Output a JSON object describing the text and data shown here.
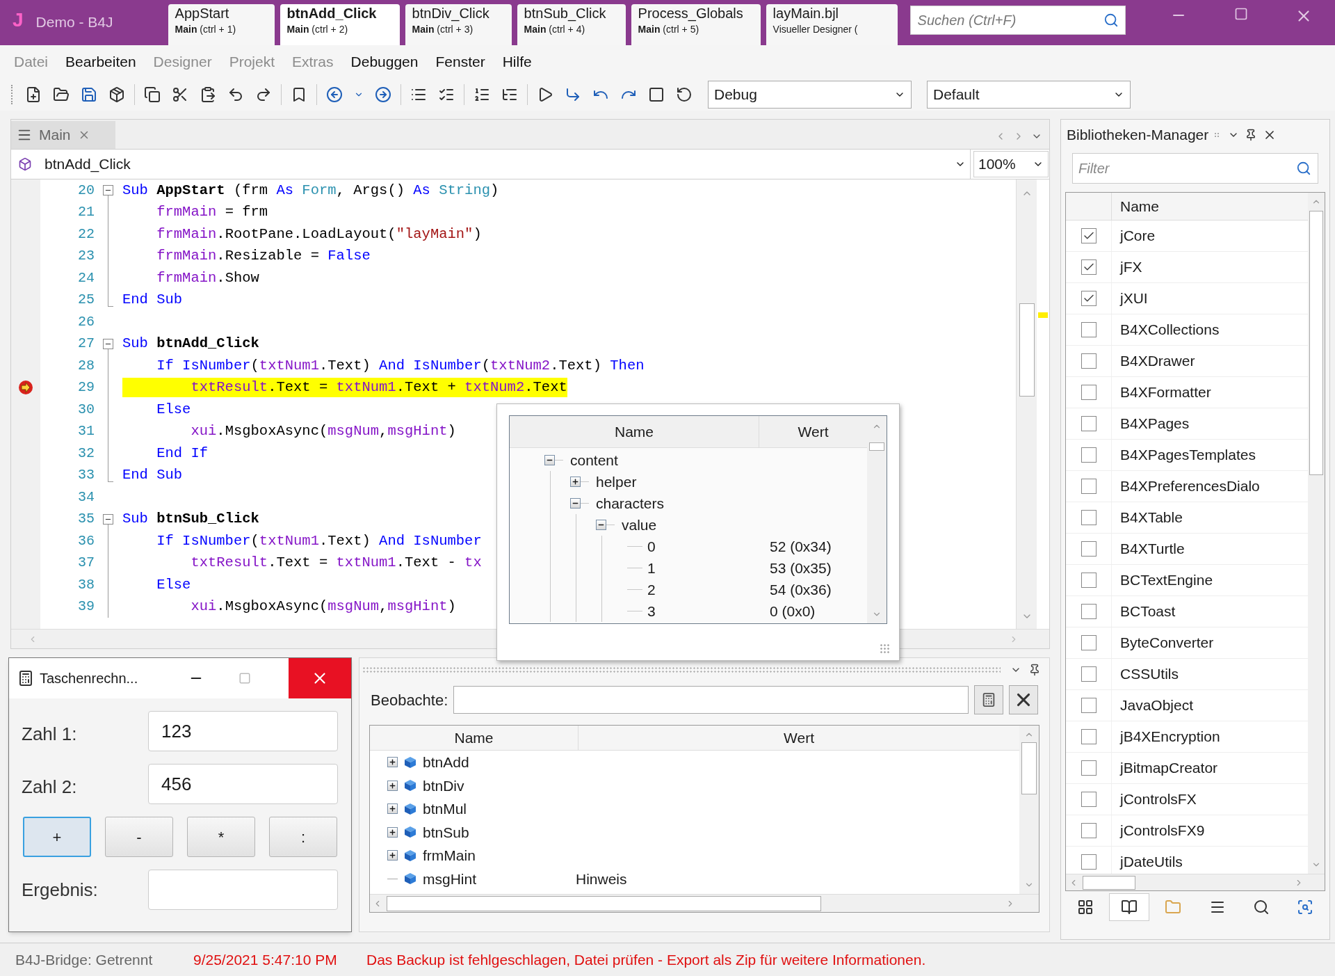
{
  "title_bar": {
    "logo": "J",
    "title": "Demo - B4J",
    "tabs": [
      {
        "title": "AppStart",
        "subtitle": "**Main** (ctrl + 1)",
        "selected": false
      },
      {
        "title": "btnAdd_Click",
        "subtitle": "**Main** (ctrl + 2)",
        "selected": true
      },
      {
        "title": "btnDiv_Click",
        "subtitle": "**Main** (ctrl + 3)",
        "selected": false
      },
      {
        "title": "btnSub_Click",
        "subtitle": "**Main** (ctrl + 4)",
        "selected": false
      },
      {
        "title": "Process_Globals",
        "subtitle": "**Main** (ctrl + 5)",
        "selected": false
      },
      {
        "title": "layMain.bjl",
        "subtitle": "Visueller Designer (",
        "selected": false
      }
    ],
    "search": {
      "placeholder": "Suchen (Ctrl+F)"
    }
  },
  "menu": [
    {
      "label": "Datei",
      "disabled": true
    },
    {
      "label": "Bearbeiten",
      "disabled": false
    },
    {
      "label": "Designer",
      "disabled": true
    },
    {
      "label": "Projekt",
      "disabled": true
    },
    {
      "label": "Extras",
      "disabled": true
    },
    {
      "label": "Debuggen",
      "disabled": false
    },
    {
      "label": "Fenster",
      "disabled": false
    },
    {
      "label": "Hilfe",
      "disabled": false
    }
  ],
  "toolbar": {
    "build_config": "Debug",
    "theme": "Default"
  },
  "editor": {
    "tab": "Main",
    "sub": "btnAdd_Click",
    "zoom": "100%",
    "lines": [
      {
        "number": "20",
        "kind": "start",
        "tokens": [
          {
            "kind": "kw",
            "text": "Sub "
          },
          {
            "kind": "name",
            "text": "AppStart"
          },
          {
            "kind": "plain",
            "text": " (frm "
          },
          {
            "kind": "kw",
            "text": "As "
          },
          {
            "kind": "type",
            "text": "Form"
          },
          {
            "kind": "plain",
            "text": ", Args() "
          },
          {
            "kind": "kw",
            "text": "As "
          },
          {
            "kind": "type",
            "text": "String"
          },
          {
            "kind": "plain",
            "text": ")"
          }
        ]
      },
      {
        "number": "21",
        "kind": "inner",
        "tokens": [
          {
            "kind": "var",
            "text": "    frmMain"
          },
          {
            "kind": "plain",
            "text": " = frm"
          }
        ]
      },
      {
        "number": "22",
        "kind": "inner",
        "tokens": [
          {
            "kind": "var",
            "text": "    frmMain"
          },
          {
            "kind": "plain",
            "text": ".RootPane.LoadLayout("
          },
          {
            "kind": "str",
            "text": "\"layMain\""
          },
          {
            "kind": "plain",
            "text": ")"
          }
        ]
      },
      {
        "number": "23",
        "kind": "inner",
        "tokens": [
          {
            "kind": "var",
            "text": "    frmMain"
          },
          {
            "kind": "plain",
            "text": ".Resizable = "
          },
          {
            "kind": "kw",
            "text": "False"
          }
        ]
      },
      {
        "number": "24",
        "kind": "inner",
        "tokens": [
          {
            "kind": "var",
            "text": "    frmMain"
          },
          {
            "kind": "plain",
            "text": ".Show"
          }
        ]
      },
      {
        "number": "25",
        "kind": "end",
        "tokens": [
          {
            "kind": "kw",
            "text": "End Sub"
          }
        ]
      },
      {
        "number": "26",
        "kind": "blank"
      },
      {
        "number": "27",
        "kind": "start",
        "tokens": [
          {
            "kind": "kw",
            "text": "Sub "
          },
          {
            "kind": "name",
            "text": "btnAdd_Click"
          }
        ]
      },
      {
        "number": "28",
        "kind": "inner",
        "tokens": [
          {
            "kind": "kw",
            "text": "    If IsNumber"
          },
          {
            "kind": "plain",
            "text": "("
          },
          {
            "kind": "var",
            "text": "txtNum1"
          },
          {
            "kind": "plain",
            "text": ".Text) "
          },
          {
            "kind": "kw",
            "text": "And IsNumber"
          },
          {
            "kind": "plain",
            "text": "("
          },
          {
            "kind": "var",
            "text": "txtNum2"
          },
          {
            "kind": "plain",
            "text": ".Text) "
          },
          {
            "kind": "kw",
            "text": "Then"
          }
        ]
      },
      {
        "number": "29",
        "kind": "inner",
        "highlight": true,
        "breakpoint": true,
        "tokens": [
          {
            "kind": "var",
            "text": "        txtResult"
          },
          {
            "kind": "plain",
            "text": ".Text = "
          },
          {
            "kind": "var",
            "text": "txtNum1"
          },
          {
            "kind": "plain",
            "text": ".Text + "
          },
          {
            "kind": "var",
            "text": "txtNum2"
          },
          {
            "kind": "plain",
            "text": ".Text"
          }
        ]
      },
      {
        "number": "30",
        "kind": "inner",
        "tokens": [
          {
            "kind": "kw",
            "text": "    Else"
          }
        ]
      },
      {
        "number": "31",
        "kind": "inner",
        "tokens": [
          {
            "kind": "var",
            "text": "        xui"
          },
          {
            "kind": "plain",
            "text": ".MsgboxAsync("
          },
          {
            "kind": "var",
            "text": "msgNum"
          },
          {
            "kind": "plain",
            "text": ","
          },
          {
            "kind": "var",
            "text": "msgHint"
          },
          {
            "kind": "plain",
            "text": ")"
          }
        ]
      },
      {
        "number": "32",
        "kind": "inner",
        "tokens": [
          {
            "kind": "kw",
            "text": "    End If"
          }
        ]
      },
      {
        "number": "33",
        "kind": "end",
        "tokens": [
          {
            "kind": "kw",
            "text": "End Sub"
          }
        ]
      },
      {
        "number": "34",
        "kind": "blank"
      },
      {
        "number": "35",
        "kind": "start",
        "tokens": [
          {
            "kind": "kw",
            "text": "Sub "
          },
          {
            "kind": "name",
            "text": "btnSub_Click"
          }
        ]
      },
      {
        "number": "36",
        "kind": "inner",
        "tokens": [
          {
            "kind": "kw",
            "text": "    If IsNumber"
          },
          {
            "kind": "plain",
            "text": "("
          },
          {
            "kind": "var",
            "text": "txtNum1"
          },
          {
            "kind": "plain",
            "text": ".Text) "
          },
          {
            "kind": "kw",
            "text": "And IsNumber"
          }
        ]
      },
      {
        "number": "37",
        "kind": "inner",
        "tokens": [
          {
            "kind": "var",
            "text": "        txtResult"
          },
          {
            "kind": "plain",
            "text": ".Text = "
          },
          {
            "kind": "var",
            "text": "txtNum1"
          },
          {
            "kind": "plain",
            "text": ".Text - "
          },
          {
            "kind": "var",
            "text": "tx"
          }
        ]
      },
      {
        "number": "38",
        "kind": "inner",
        "tokens": [
          {
            "kind": "kw",
            "text": "    Else"
          }
        ]
      },
      {
        "number": "39",
        "kind": "inner",
        "tokens": [
          {
            "kind": "var",
            "text": "        xui"
          },
          {
            "kind": "plain",
            "text": ".MsgboxAsync("
          },
          {
            "kind": "var",
            "text": "msgNum"
          },
          {
            "kind": "plain",
            "text": ","
          },
          {
            "kind": "var",
            "text": "msgHint"
          },
          {
            "kind": "plain",
            "text": ")"
          }
        ]
      }
    ]
  },
  "popup": {
    "columns": [
      "Name",
      "Wert"
    ],
    "tree": [
      {
        "name": "content",
        "expanded": true,
        "children": [
          {
            "name": "helper",
            "expanded": false
          },
          {
            "name": "characters",
            "expanded": true,
            "children": [
              {
                "name": "value",
                "expanded": true,
                "children": [
                  {
                    "name": "0",
                    "value": "52 (0x34)"
                  },
                  {
                    "name": "1",
                    "value": "53 (0x35)"
                  },
                  {
                    "name": "2",
                    "value": "54 (0x36)"
                  },
                  {
                    "name": "3",
                    "value": "0 (0x0)"
                  }
                ]
              }
            ]
          }
        ]
      }
    ]
  },
  "calculator": {
    "title": "Taschenrechn...",
    "fields": [
      {
        "label": "Zahl 1:",
        "value": "123"
      },
      {
        "label": "Zahl 2:",
        "value": "456"
      }
    ],
    "buttons": [
      {
        "label": "+",
        "focused": true
      },
      {
        "label": "-",
        "focused": false
      },
      {
        "label": "*",
        "focused": false
      },
      {
        "label": ":",
        "focused": false
      }
    ],
    "result_label": "Ergebnis:"
  },
  "watch": {
    "label": "Beobachte:",
    "columns": [
      "Name",
      "Wert"
    ],
    "rows": [
      {
        "name": "btnAdd",
        "expanded": false
      },
      {
        "name": "btnDiv",
        "expanded": false
      },
      {
        "name": "btnMul",
        "expanded": false
      },
      {
        "name": "btnSub",
        "expanded": false
      },
      {
        "name": "frmMain",
        "expanded": false
      },
      {
        "name": "msgHint",
        "value": "Hinweis"
      }
    ]
  },
  "libraries": {
    "title": "Bibliotheken-Manager",
    "filter_placeholder": "Filter",
    "column": "Name",
    "items": [
      {
        "name": "jCore",
        "checked": true
      },
      {
        "name": "jFX",
        "checked": true
      },
      {
        "name": "jXUI",
        "checked": true
      },
      {
        "name": "B4XCollections",
        "checked": false
      },
      {
        "name": "B4XDrawer",
        "checked": false
      },
      {
        "name": "B4XFormatter",
        "checked": false
      },
      {
        "name": "B4XPages",
        "checked": false
      },
      {
        "name": "B4XPagesTemplates",
        "checked": false
      },
      {
        "name": "B4XPreferencesDialo",
        "checked": false
      },
      {
        "name": "B4XTable",
        "checked": false
      },
      {
        "name": "B4XTurtle",
        "checked": false
      },
      {
        "name": "BCTextEngine",
        "checked": false
      },
      {
        "name": "BCToast",
        "checked": false
      },
      {
        "name": "ByteConverter",
        "checked": false
      },
      {
        "name": "CSSUtils",
        "checked": false
      },
      {
        "name": "JavaObject",
        "checked": false
      },
      {
        "name": "jB4XEncryption",
        "checked": false
      },
      {
        "name": "jBitmapCreator",
        "checked": false
      },
      {
        "name": "jControlsFX",
        "checked": false
      },
      {
        "name": "jControlsFX9",
        "checked": false
      },
      {
        "name": "jDateUtils",
        "checked": false
      }
    ],
    "bottom_tabs": [
      {
        "kind": "modules",
        "selected": false
      },
      {
        "kind": "libraries",
        "selected": true
      },
      {
        "kind": "files",
        "selected": false
      },
      {
        "kind": "logs",
        "selected": false
      },
      {
        "kind": "search",
        "selected": false
      },
      {
        "kind": "designer",
        "selected": false
      }
    ]
  },
  "status_bar": {
    "bridge": "B4J-Bridge: Getrennt",
    "time": "9/25/2021 5:47:10 PM",
    "message": "Das Backup ist fehlgeschlagen, Datei prüfen - Export als Zip für weitere Informationen."
  }
}
